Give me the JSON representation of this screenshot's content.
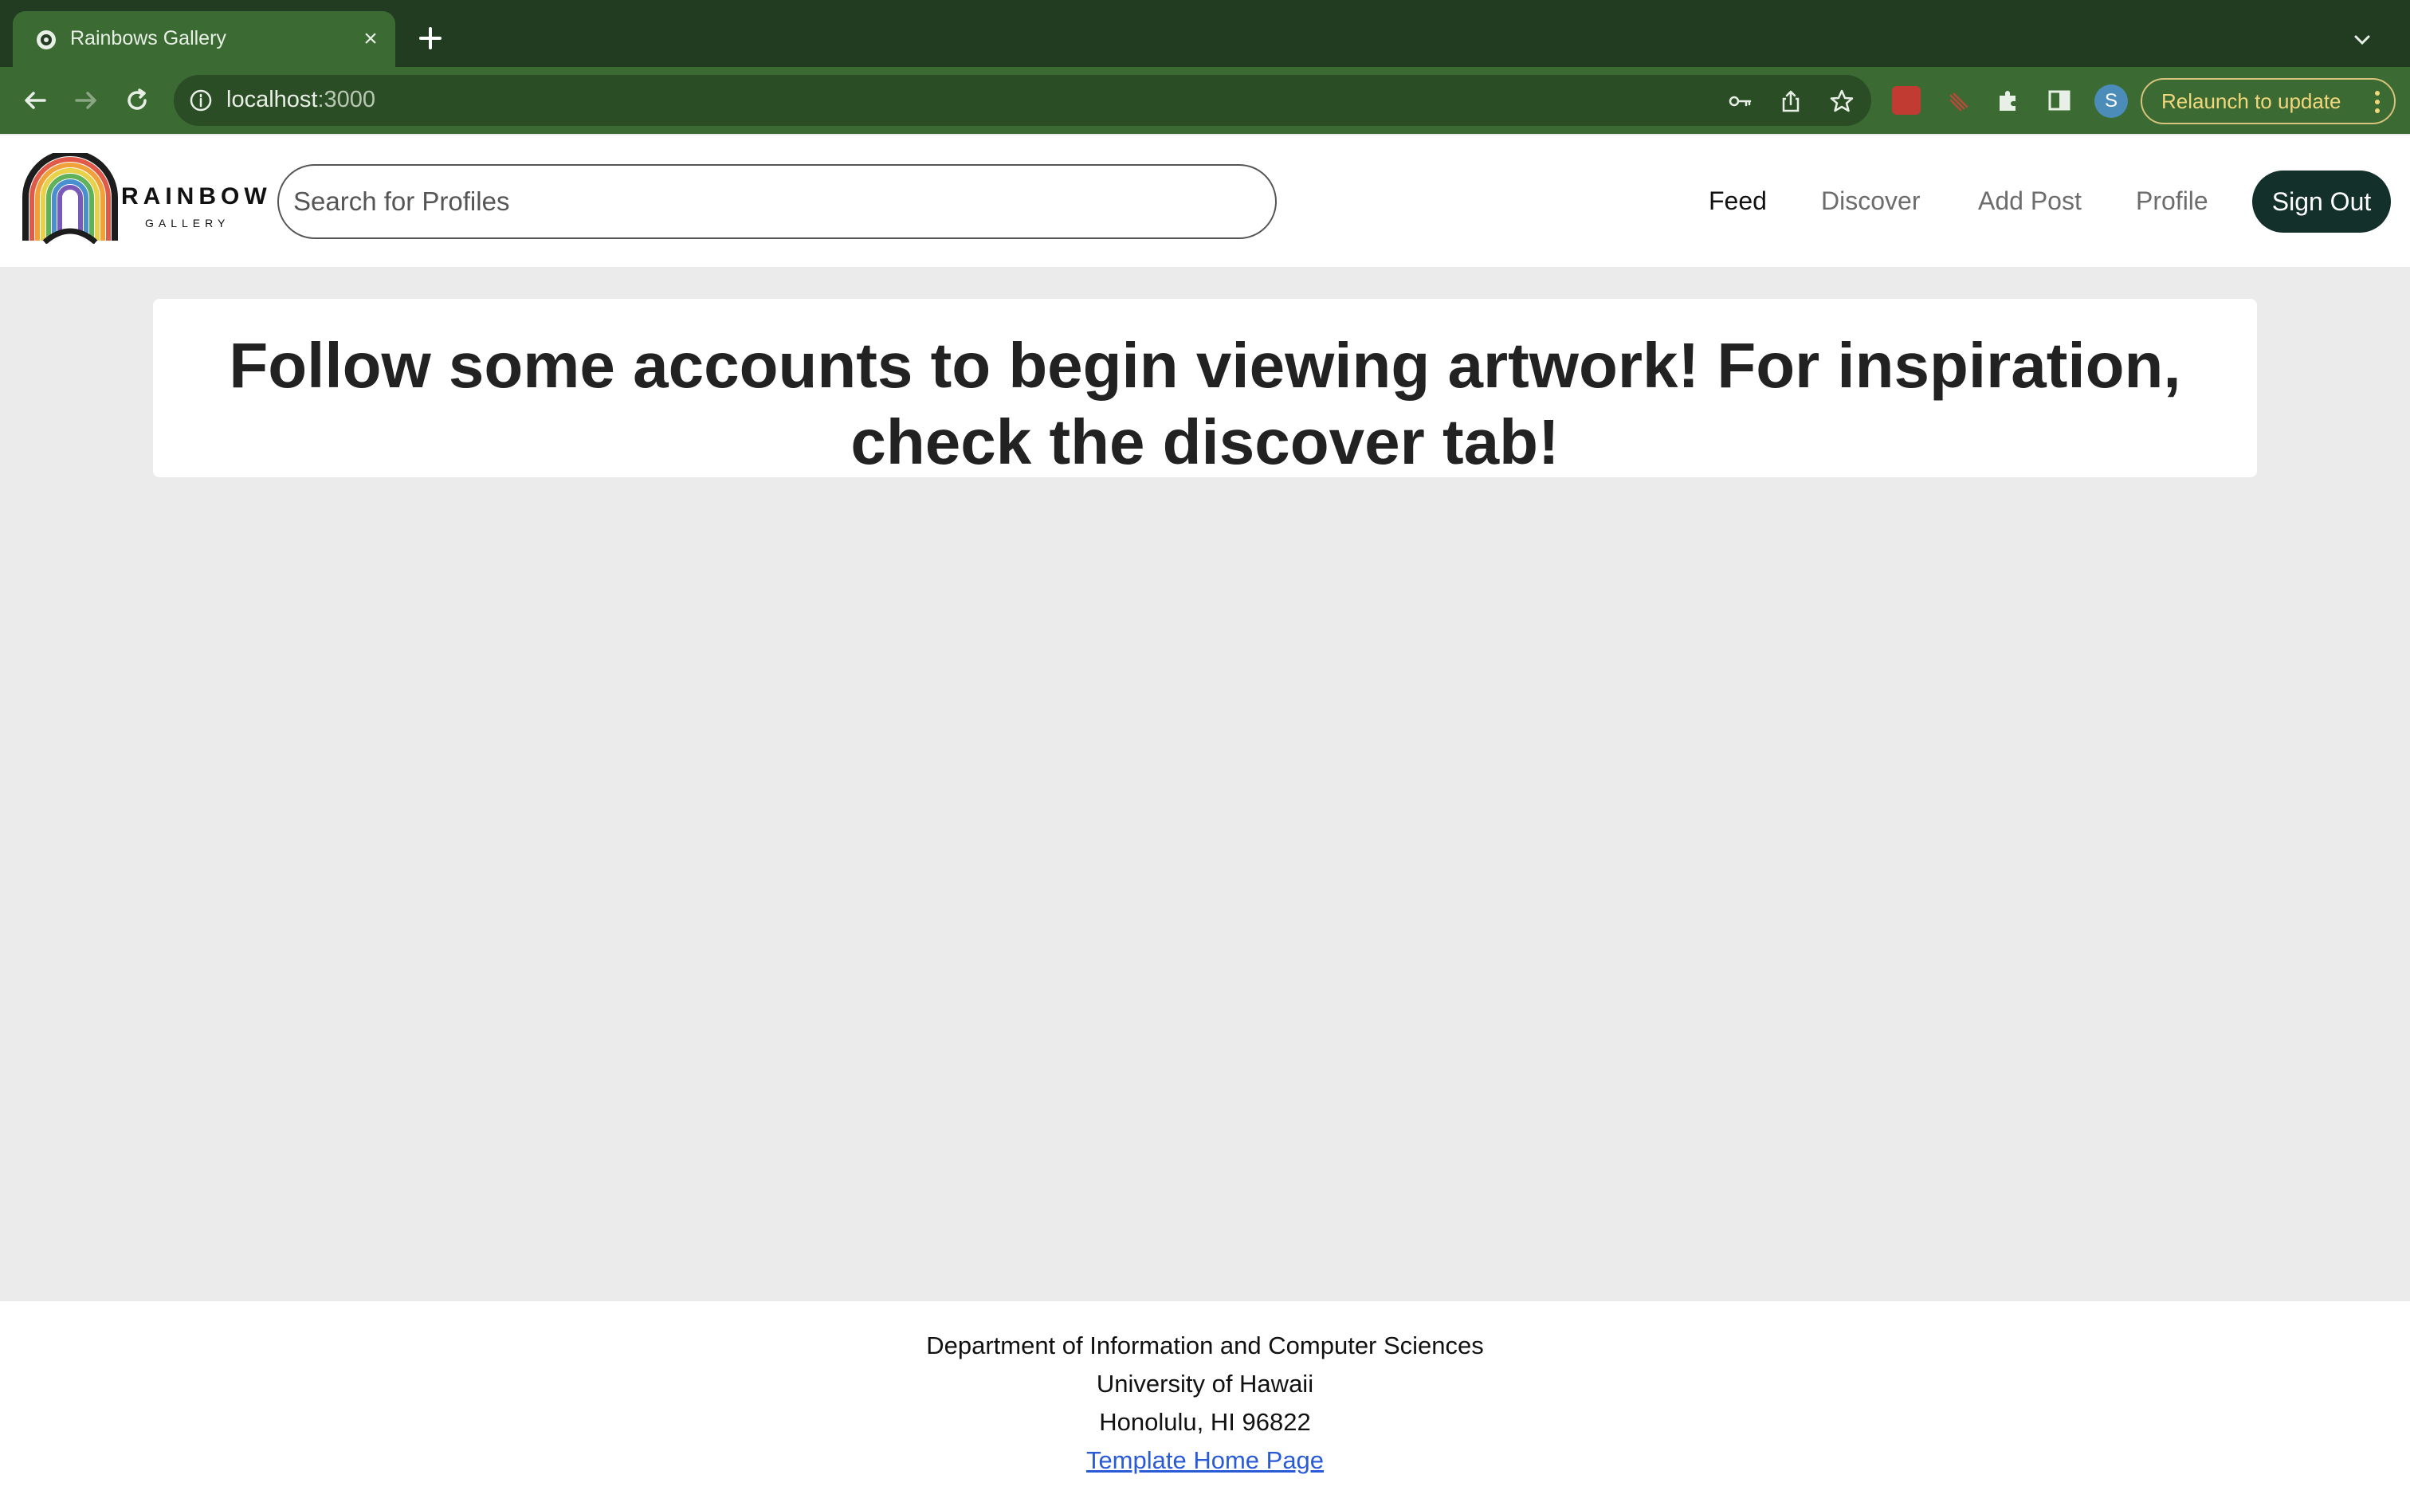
{
  "browser": {
    "tab_title": "Rainbows Gallery",
    "url_host": "localhost",
    "url_port": ":3000",
    "relaunch_label": "Relaunch to update",
    "profile_initial": "S"
  },
  "navbar": {
    "logo_word": "RAINBOW",
    "logo_sub": "GALLERY",
    "search_placeholder": "Search for Profiles",
    "links": [
      {
        "label": "Feed",
        "active": true
      },
      {
        "label": "Discover",
        "active": false
      },
      {
        "label": "Add Post",
        "active": false
      },
      {
        "label": "Profile",
        "active": false
      }
    ],
    "signout_label": "Sign Out"
  },
  "main": {
    "message": "Follow some accounts to begin viewing artwork! For inspiration, check the discover tab!"
  },
  "footer": {
    "line1": "Department of Information and Computer Sciences",
    "line2": "University of Hawaii",
    "line3": "Honolulu, HI 96822",
    "link_label": "Template Home Page"
  },
  "colors": {
    "chrome_dark": "#213c21",
    "chrome_toolbar": "#3b6a33",
    "signout_bg": "#14302a",
    "page_bg": "#ebebeb",
    "link": "#2a5bd7"
  }
}
